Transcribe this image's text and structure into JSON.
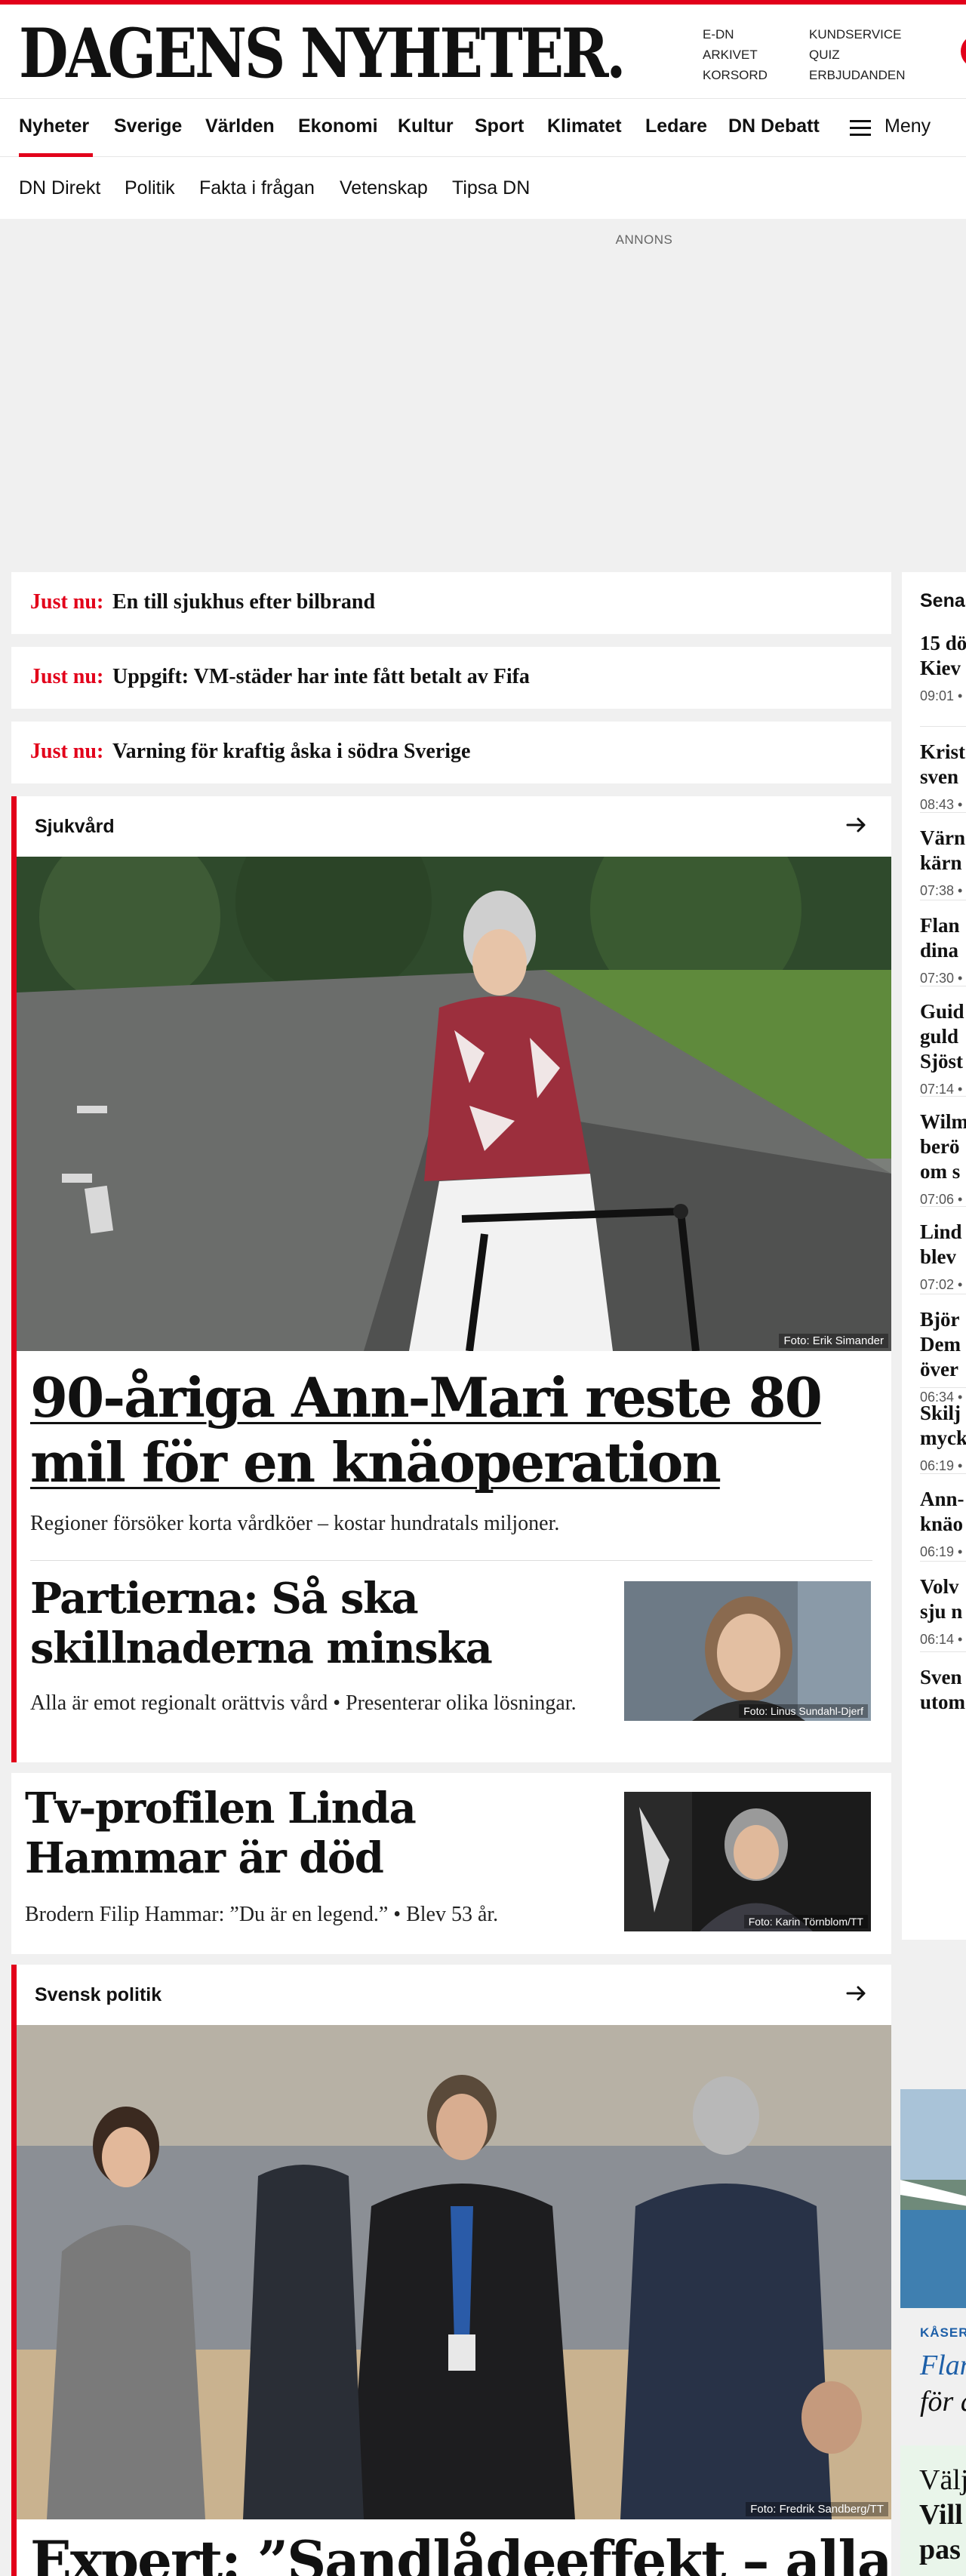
{
  "brand": {
    "name": "DAGENS NYHETER.",
    "accent": "#e2001a"
  },
  "util_links": {
    "col1": [
      "E-DN",
      "ARKIVET",
      "KORSORD"
    ],
    "col2": [
      "KUNDSERVICE",
      "QUIZ",
      "ERBJUDANDEN"
    ]
  },
  "main_nav": [
    "Nyheter",
    "Sverige",
    "Världen",
    "Ekonomi",
    "Kultur",
    "Sport",
    "Klimatet",
    "Ledare",
    "DN Debatt"
  ],
  "menu_label": "Meny",
  "sub_nav": [
    "DN Direkt",
    "Politik",
    "Fakta i frågan",
    "Vetenskap",
    "Tipsa DN"
  ],
  "ad_label": "ANNONS",
  "just_nu": {
    "label": "Just nu:",
    "items": [
      "En till sjukhus efter bilbrand",
      "Uppgift: VM-städer har inte fått betalt av Fifa",
      "Varning för kraftig åska i södra Sverige"
    ]
  },
  "section_health": {
    "title": "Sjukvård",
    "hero_credit": "Foto: Erik Simander",
    "headline": "90-åriga Ann-Mari reste 80 mil för en knäoperation",
    "dek": "Regioner försöker korta vårdköer – kostar hundratals miljoner.",
    "second": {
      "headline": "Partierna: Så ska skillnaderna minska",
      "dek": "Alla är emot regionalt orättvis vård • Presenterar olika lösningar.",
      "credit": "Foto: Linus Sundahl-Djerf"
    }
  },
  "linda": {
    "headline": "Tv-profilen Linda Hammar är död",
    "dek": "Brodern Filip Hammar: ”Du är en legend.” • Blev 53 år.",
    "credit": "Foto: Karin Törnblom/TT"
  },
  "section_politics": {
    "title": "Svensk politik",
    "hero_credit": "Foto: Fredrik Sandberg/TT",
    "headline": "Expert: ”Sandlådeeffekt – alla"
  },
  "sidebar": {
    "title": "Senaste nytt",
    "items": [
      {
        "lines": [
          "15 dö",
          "Kiev"
        ],
        "time": "09:01 •"
      },
      {
        "lines": [
          "Krist",
          "sven"
        ],
        "time": "08:43 •"
      },
      {
        "lines": [
          "Värn",
          "kärn"
        ],
        "time": "07:38 •"
      },
      {
        "lines": [
          "Flan",
          "dina"
        ],
        "time": "07:30 •"
      },
      {
        "lines": [
          "Guid",
          "guld",
          "Sjöst"
        ],
        "time": "07:14 •"
      },
      {
        "lines": [
          "Wilm",
          "berö",
          "om s"
        ],
        "time": "07:06 •"
      },
      {
        "lines": [
          "Lind",
          "blev"
        ],
        "time": "07:02 •"
      },
      {
        "lines": [
          "Björ",
          "Dem",
          "över"
        ],
        "time": "06:34 •"
      },
      {
        "lines": [
          "Skilj",
          "myck"
        ],
        "time": "06:19 •"
      },
      {
        "lines": [
          "Ann-",
          "knäo"
        ],
        "time": "06:19 •"
      },
      {
        "lines": [
          "Volv",
          "sju n"
        ],
        "time": "06:14 •"
      },
      {
        "lines": [
          "Sven",
          "utom"
        ],
        "time": ""
      }
    ]
  },
  "promo": {
    "kicker": "KÅSER",
    "title": "Flan",
    "sub": "för d"
  },
  "green_box": {
    "line1": "Välj",
    "line2": "Vill",
    "line3": "pas"
  }
}
